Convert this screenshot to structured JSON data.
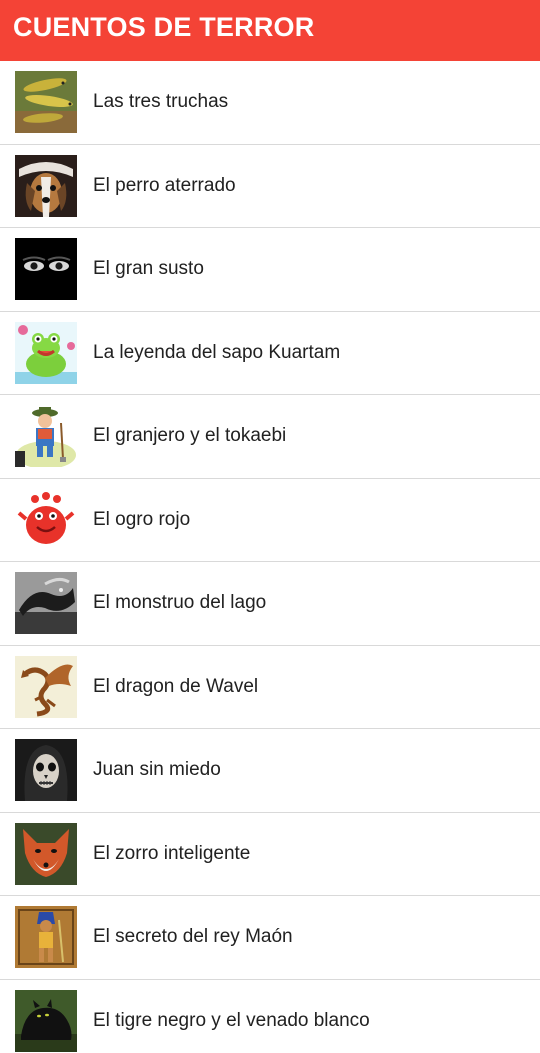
{
  "appbar": {
    "title": "CUENTOS DE TERROR",
    "color": "#f44336"
  },
  "stories": [
    {
      "title": "Las tres truchas",
      "icon": "trout-thumbnail"
    },
    {
      "title": "El perro aterrado",
      "icon": "dog-thumbnail"
    },
    {
      "title": "El gran susto",
      "icon": "eyes-in-dark-thumbnail"
    },
    {
      "title": "La leyenda del sapo Kuartam",
      "icon": "frog-thumbnail"
    },
    {
      "title": "El granjero y el tokaebi",
      "icon": "farmer-thumbnail"
    },
    {
      "title": "El ogro rojo",
      "icon": "red-ogre-thumbnail"
    },
    {
      "title": "El monstruo del lago",
      "icon": "lake-monster-thumbnail"
    },
    {
      "title": "El dragon de Wavel",
      "icon": "dragon-thumbnail"
    },
    {
      "title": "Juan sin miedo",
      "icon": "skull-face-thumbnail"
    },
    {
      "title": "El zorro inteligente",
      "icon": "fox-thumbnail"
    },
    {
      "title": "El secreto del rey Maón",
      "icon": "egyptian-king-thumbnail"
    },
    {
      "title": "El tigre negro y el venado blanco",
      "icon": "black-panther-thumbnail"
    }
  ]
}
